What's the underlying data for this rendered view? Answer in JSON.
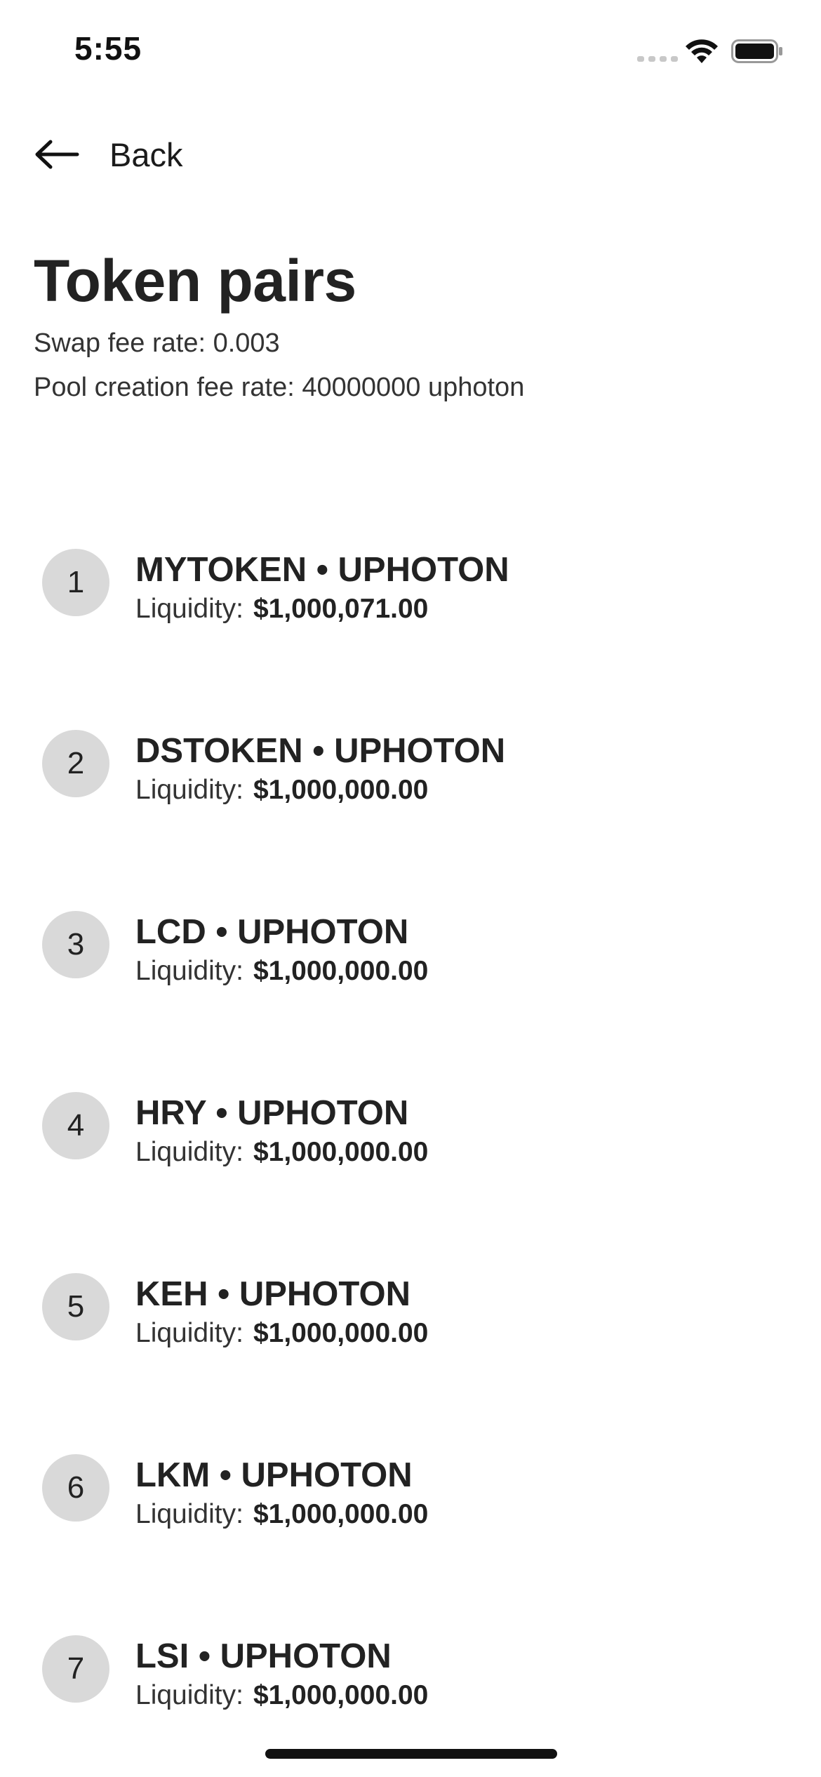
{
  "status_bar": {
    "time": "5:55",
    "icons": [
      "cellular-signal-icon",
      "wifi-icon",
      "battery-icon"
    ]
  },
  "nav": {
    "back_label": "Back",
    "back_icon": "arrow-left-icon"
  },
  "header": {
    "title": "Token pairs",
    "swap_fee": "Swap fee rate: 0.003",
    "pool_fee": "Pool creation fee rate: 40000000 uphoton"
  },
  "pairs": {
    "liquidity_label": "Liquidity:",
    "items": [
      {
        "index": "1",
        "name": "MYTOKEN • UPHOTON",
        "liquidity": "$1,000,071.00"
      },
      {
        "index": "2",
        "name": "DSTOKEN • UPHOTON",
        "liquidity": "$1,000,000.00"
      },
      {
        "index": "3",
        "name": "LCD • UPHOTON",
        "liquidity": "$1,000,000.00"
      },
      {
        "index": "4",
        "name": "HRY • UPHOTON",
        "liquidity": "$1,000,000.00"
      },
      {
        "index": "5",
        "name": "KEH • UPHOTON",
        "liquidity": "$1,000,000.00"
      },
      {
        "index": "6",
        "name": "LKM • UPHOTON",
        "liquidity": "$1,000,000.00"
      },
      {
        "index": "7",
        "name": "LSI • UPHOTON",
        "liquidity": "$1,000,000.00"
      }
    ]
  },
  "colors": {
    "background": "#ffffff",
    "text": "#222222",
    "badge": "#d9d9d9",
    "home_indicator": "#111111"
  }
}
